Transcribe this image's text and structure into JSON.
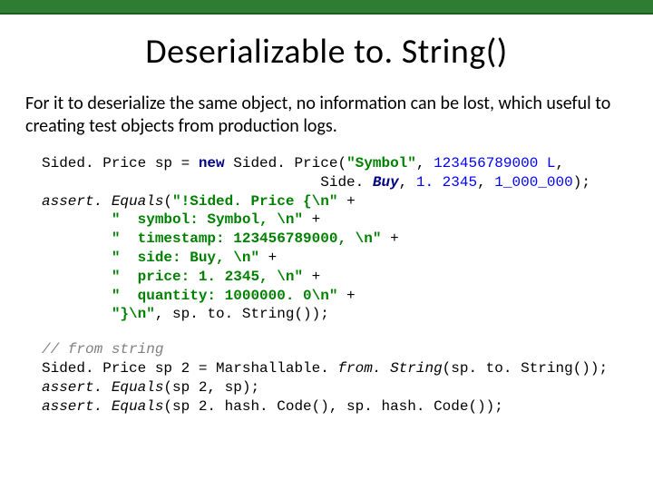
{
  "title": "Deserializable to. String()",
  "paragraph": "For it to deserialize the same object, no information can be lost, which useful to creating test objects from production logs.",
  "code1": {
    "l1a": "Sided. Price sp = ",
    "l1_new": "new ",
    "l1b": "Sided. Price(",
    "l1_str": "\"Symbol\"",
    "l1c": ", ",
    "l1_num1": "123456789000 L",
    "l1d": ",",
    "l2a": "                                Side. ",
    "l2_buy": "Buy",
    "l2b": ", ",
    "l2_num1": "1. 2345",
    "l2c": ", ",
    "l2_num2": "1_000_000",
    "l2d": ");",
    "l3a": "assert. Equals",
    "l3b": "(",
    "l3_str": "\"!Sided. Price {\\n\"",
    "l3c": " +",
    "l4_str": "        \"  symbol: Symbol, \\n\"",
    "l4c": " +",
    "l5_str": "        \"  timestamp: 123456789000, \\n\"",
    "l5c": " +",
    "l6_str": "        \"  side: Buy, \\n\"",
    "l6c": " +",
    "l7_str": "        \"  price: 1. 2345, \\n\"",
    "l7c": " +",
    "l8_str": "        \"  quantity: 1000000. 0\\n\"",
    "l8c": " +",
    "l9_str": "        \"}\\n\"",
    "l9c": ", sp. to. String());"
  },
  "code2": {
    "c1": "// from string",
    "l1a": "Sided. Price sp 2 = Marshallable. ",
    "l1m": "from. String",
    "l1b": "(sp. to. String());",
    "l2a": "assert. Equals",
    "l2b": "(sp 2, sp);",
    "l3a": "assert. Equals",
    "l3b": "(sp 2. hash. Code(), sp. hash. Code());"
  }
}
